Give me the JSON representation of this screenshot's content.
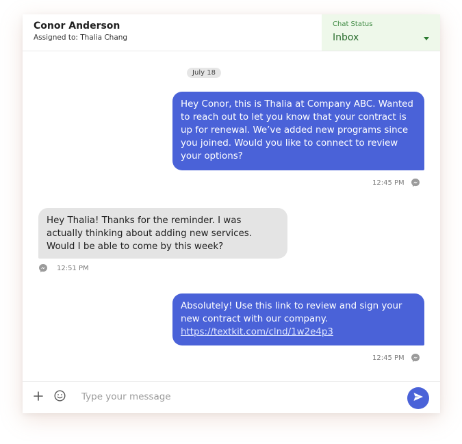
{
  "header": {
    "contact_name": "Conor Anderson",
    "assigned_to": "Assigned to: Thalia Chang"
  },
  "chat_status": {
    "label": "Chat Status",
    "value": "Inbox"
  },
  "date_separator": "July 18",
  "messages": [
    {
      "direction": "outgoing",
      "text": "Hey Conor, this is Thalia at Company ABC. Wanted to reach out to let you know that your contract is up for renewal. We’ve added new programs since you joined. Would you like to connect to review your options?",
      "time": "12:45 PM",
      "channel_icon": "messenger-icon"
    },
    {
      "direction": "incoming",
      "text": "Hey Thalia! Thanks for the reminder. I was actually thinking about adding new services. Would I be able to come by this week?",
      "time": "12:51 PM",
      "channel_icon": "messenger-icon"
    },
    {
      "direction": "outgoing",
      "text": "Absolutely! Use this link to review and sign your new contract with our company.",
      "link": "https://textkit.com/clnd/1w2e4p3",
      "time": "12:45 PM",
      "channel_icon": "messenger-icon"
    }
  ],
  "composer": {
    "placeholder": "Type your message",
    "attach_icon": "plus-icon",
    "emoji_icon": "smiley-icon",
    "send_icon": "paper-plane-icon"
  },
  "colors": {
    "accent": "#4a62d8",
    "status_bg": "#eef8ea",
    "status_text": "#2b6e2f",
    "incoming_bubble": "#e4e4e4"
  }
}
